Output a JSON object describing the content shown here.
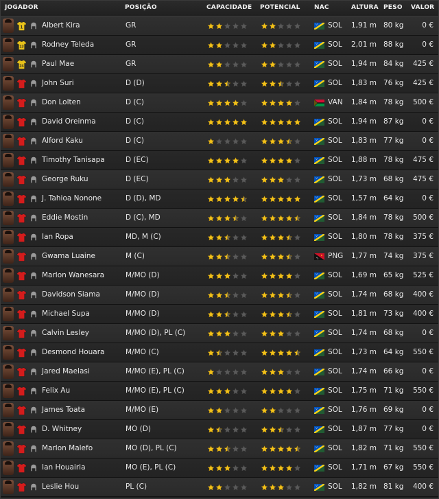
{
  "columns": {
    "player": "JOGADOR",
    "position": "POSIÇÃO",
    "ability": "CAPACIDADE",
    "potential": "POTENCIAL",
    "nation": "NAC",
    "height": "ALTURA",
    "weight": "PESO",
    "value": "VALOR"
  },
  "colors": {
    "star_gold": "#f3c21a",
    "star_empty": "#5a5a5a",
    "shirt_red": "#d41c1c",
    "shirt_yellow": "#e8c21a"
  },
  "icons": [
    "player-face-icon",
    "kit-shirt-icon",
    "head-profile-icon",
    "star-icon",
    "flag-icon"
  ],
  "players": [
    {
      "name": "Albert Kira",
      "position": "GR",
      "ability": 2,
      "potential": 2,
      "nation": "SOL",
      "height": "1,91 m",
      "weight": "80 kg",
      "value": "0 €",
      "shirt": "yellow",
      "shirt_number": "1"
    },
    {
      "name": "Rodney Teleda",
      "position": "GR",
      "ability": 2,
      "potential": 2,
      "nation": "SOL",
      "height": "2,01 m",
      "weight": "88 kg",
      "value": "0 €",
      "shirt": "yellow",
      "shirt_number": "13"
    },
    {
      "name": "Paul Mae",
      "position": "GR",
      "ability": 2,
      "potential": 2,
      "nation": "SOL",
      "height": "1,94 m",
      "weight": "84 kg",
      "value": "425 €",
      "shirt": "yellow",
      "shirt_number": "24"
    },
    {
      "name": "John Suri",
      "position": "D (D)",
      "ability": 2.5,
      "potential": 2.5,
      "nation": "SOL",
      "height": "1,83 m",
      "weight": "76 kg",
      "value": "425 €",
      "shirt": "red",
      "shirt_number": ""
    },
    {
      "name": "Don Lolten",
      "position": "D (C)",
      "ability": 4,
      "potential": 4,
      "nation": "VAN",
      "height": "1,84 m",
      "weight": "78 kg",
      "value": "500 €",
      "shirt": "red",
      "shirt_number": ""
    },
    {
      "name": "David Oreinma",
      "position": "D (C)",
      "ability": 5,
      "potential": 5,
      "nation": "SOL",
      "height": "1,94 m",
      "weight": "87 kg",
      "value": "0 €",
      "shirt": "red",
      "shirt_number": ""
    },
    {
      "name": "Alford Kaku",
      "position": "D (C)",
      "ability": 1,
      "potential": 3.5,
      "nation": "SOL",
      "height": "1,83 m",
      "weight": "77 kg",
      "value": "0 €",
      "shirt": "red",
      "shirt_number": ""
    },
    {
      "name": "Timothy Tanisapa",
      "position": "D (EC)",
      "ability": 4,
      "potential": 4,
      "nation": "SOL",
      "height": "1,88 m",
      "weight": "78 kg",
      "value": "475 €",
      "shirt": "red",
      "shirt_number": ""
    },
    {
      "name": "George Ruku",
      "position": "D (EC)",
      "ability": 3,
      "potential": 3,
      "nation": "SOL",
      "height": "1,73 m",
      "weight": "68 kg",
      "value": "475 €",
      "shirt": "red",
      "shirt_number": ""
    },
    {
      "name": "J. Tahioa Nonone",
      "position": "D (D), MD",
      "ability": 4.5,
      "potential": 5,
      "nation": "SOL",
      "height": "1,57 m",
      "weight": "64 kg",
      "value": "0 €",
      "shirt": "red",
      "shirt_number": ""
    },
    {
      "name": "Eddie Mostin",
      "position": "D (C), MD",
      "ability": 3.5,
      "potential": 4.5,
      "nation": "SOL",
      "height": "1,84 m",
      "weight": "78 kg",
      "value": "500 €",
      "shirt": "red",
      "shirt_number": ""
    },
    {
      "name": "Ian Ropa",
      "position": "MD, M (C)",
      "ability": 2.5,
      "potential": 3.5,
      "nation": "SOL",
      "height": "1,80 m",
      "weight": "78 kg",
      "value": "375 €",
      "shirt": "red",
      "shirt_number": ""
    },
    {
      "name": "Gwama Luaine",
      "position": "M (C)",
      "ability": 2.5,
      "potential": 3.5,
      "nation": "PNG",
      "height": "1,77 m",
      "weight": "74 kg",
      "value": "375 €",
      "shirt": "red",
      "shirt_number": ""
    },
    {
      "name": "Marlon Wanesara",
      "position": "M/MO (D)",
      "ability": 3,
      "potential": 4,
      "nation": "SOL",
      "height": "1,69 m",
      "weight": "65 kg",
      "value": "525 €",
      "shirt": "red",
      "shirt_number": ""
    },
    {
      "name": "Davidson Siama",
      "position": "M/MO (D)",
      "ability": 2.5,
      "potential": 3.5,
      "nation": "SOL",
      "height": "1,74 m",
      "weight": "68 kg",
      "value": "400 €",
      "shirt": "red",
      "shirt_number": ""
    },
    {
      "name": "Michael Supa",
      "position": "M/MO (D)",
      "ability": 2.5,
      "potential": 3.5,
      "nation": "SOL",
      "height": "1,81 m",
      "weight": "73 kg",
      "value": "400 €",
      "shirt": "red",
      "shirt_number": ""
    },
    {
      "name": "Calvin Lesley",
      "position": "M/MO (D), PL (C)",
      "ability": 3,
      "potential": 3,
      "nation": "SOL",
      "height": "1,74 m",
      "weight": "68 kg",
      "value": "0 €",
      "shirt": "red",
      "shirt_number": ""
    },
    {
      "name": "Desmond Houara",
      "position": "M/MO (C)",
      "ability": 1.5,
      "potential": 4.5,
      "nation": "SOL",
      "height": "1,73 m",
      "weight": "64 kg",
      "value": "550 €",
      "shirt": "red",
      "shirt_number": ""
    },
    {
      "name": "Jared Maelasi",
      "position": "M/MO (E), PL (C)",
      "ability": 1,
      "potential": 3,
      "nation": "SOL",
      "height": "1,74 m",
      "weight": "66 kg",
      "value": "0 €",
      "shirt": "red",
      "shirt_number": ""
    },
    {
      "name": "Felix Au",
      "position": "M/MO (E), PL (C)",
      "ability": 3,
      "potential": 4,
      "nation": "SOL",
      "height": "1,75 m",
      "weight": "71 kg",
      "value": "550 €",
      "shirt": "red",
      "shirt_number": ""
    },
    {
      "name": "James Toata",
      "position": "M/MO (E)",
      "ability": 2,
      "potential": 2,
      "nation": "SOL",
      "height": "1,76 m",
      "weight": "69 kg",
      "value": "0 €",
      "shirt": "red",
      "shirt_number": ""
    },
    {
      "name": "D. Whitney",
      "position": "MO (D)",
      "ability": 1.5,
      "potential": 2.5,
      "nation": "SOL",
      "height": "1,87 m",
      "weight": "77 kg",
      "value": "0 €",
      "shirt": "red",
      "shirt_number": ""
    },
    {
      "name": "Marlon Malefo",
      "position": "MO (D), PL (C)",
      "ability": 2.5,
      "potential": 4.5,
      "nation": "SOL",
      "height": "1,82 m",
      "weight": "71 kg",
      "value": "550 €",
      "shirt": "red",
      "shirt_number": ""
    },
    {
      "name": "Ian Houairia",
      "position": "MO (E), PL (C)",
      "ability": 3,
      "potential": 4,
      "nation": "SOL",
      "height": "1,71 m",
      "weight": "67 kg",
      "value": "550 €",
      "shirt": "red",
      "shirt_number": ""
    },
    {
      "name": "Leslie Hou",
      "position": "PL (C)",
      "ability": 2,
      "potential": 3,
      "nation": "SOL",
      "height": "1,82 m",
      "weight": "81 kg",
      "value": "400 €",
      "shirt": "red",
      "shirt_number": ""
    }
  ]
}
